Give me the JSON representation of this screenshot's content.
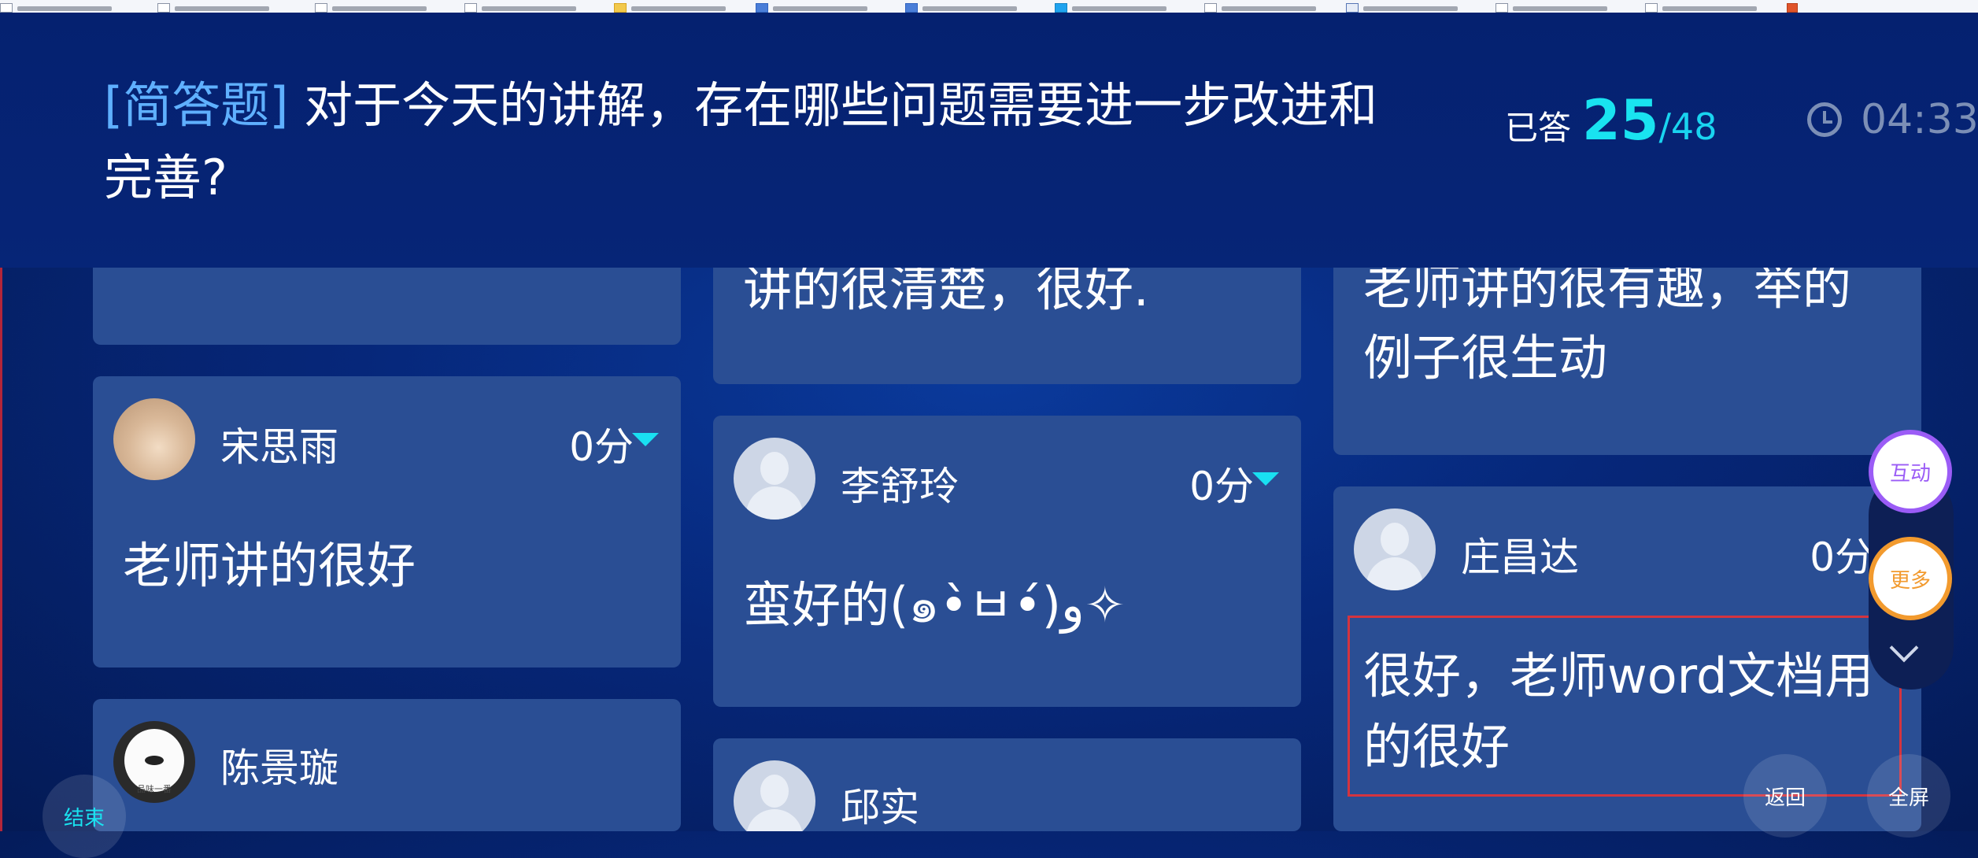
{
  "question": {
    "type_label": "[简答题]",
    "text": "对于今天的讲解，存在哪些问题需要进一步改进和完善?"
  },
  "progress": {
    "label": "已答",
    "answered": "25",
    "total": "/48"
  },
  "timer": {
    "value": "04:33",
    "icon": "clock-icon"
  },
  "columns": [
    {
      "cards": [
        {
          "name": "",
          "score": "",
          "content": "",
          "avatar": ""
        },
        {
          "name": "宋思雨",
          "score": "0分",
          "content": "老师讲的很好",
          "avatar": "photo"
        },
        {
          "name": "陈景璇",
          "score": "",
          "content": "",
          "avatar": "photo",
          "avatar_caption": "品味一番"
        }
      ]
    },
    {
      "cards": [
        {
          "name": "",
          "score": "",
          "content": "讲的很清楚，很好.",
          "avatar": ""
        },
        {
          "name": "李舒玲",
          "score": "0分",
          "content": "蛮好的(๑•̀ㅂ•́)و✧",
          "avatar": "default"
        },
        {
          "name": "邱实",
          "score": "",
          "content": "",
          "avatar": "default"
        }
      ]
    },
    {
      "cards": [
        {
          "name": "",
          "score": "",
          "content": "老师讲的很有趣，举的例子很生动",
          "avatar": ""
        },
        {
          "name": "庄昌达",
          "score": "0分",
          "content": "很好，老师word文档用的很好",
          "avatar": "default"
        }
      ]
    }
  ],
  "side_buttons": {
    "interact": "互动",
    "more": "更多",
    "collapse_icon": "chevron-down-icon"
  },
  "bottom": {
    "end": "结束",
    "back": "返回",
    "fullscreen": "全屏"
  },
  "colors": {
    "background": "#06277a",
    "card": "#2a4e94",
    "accent_cyan": "#19e3f0",
    "type_label": "#5fb0ff",
    "interact_border": "#9b5cf6",
    "more_border": "#f29a2e",
    "highlight_border": "#d4343f"
  }
}
